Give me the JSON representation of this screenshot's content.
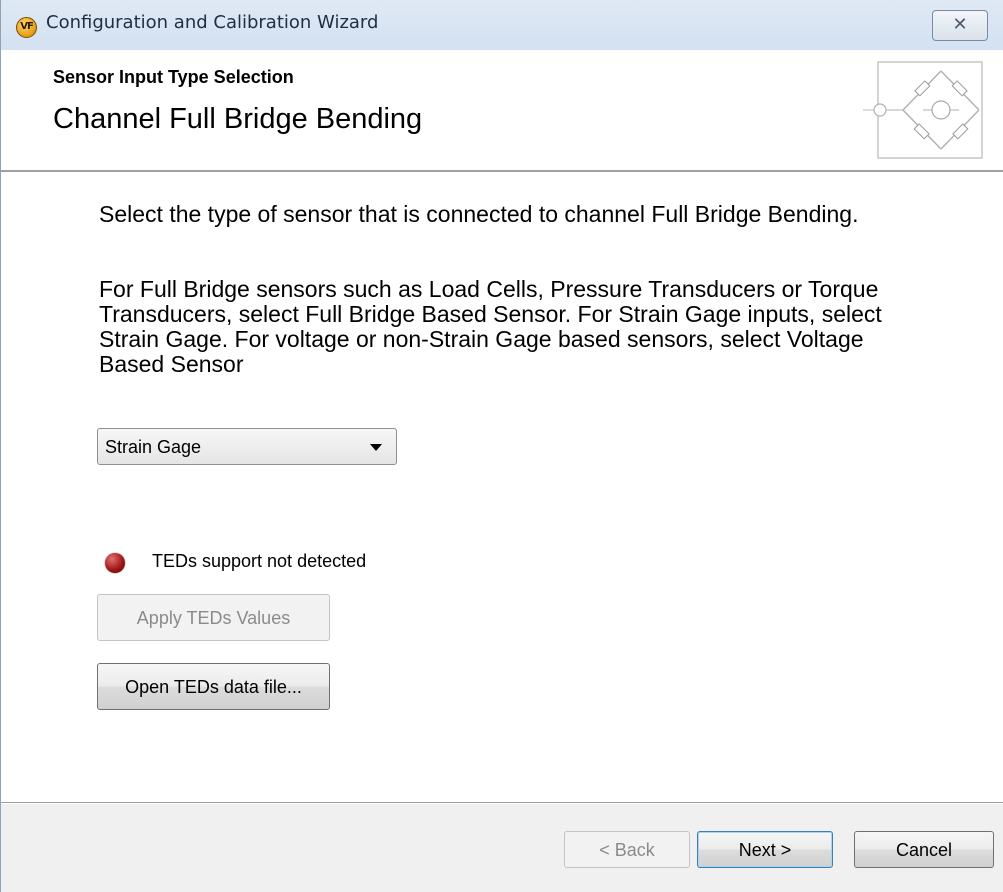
{
  "window": {
    "title": "Configuration and Calibration Wizard",
    "icon_label": "VF",
    "close_label": "✕"
  },
  "header": {
    "subtitle": "Sensor Input Type Selection",
    "title": "Channel Full Bridge Bending",
    "image_icon": "bridge-circuit-icon"
  },
  "content": {
    "instruction": "Select the type of sensor that is connected to channel Full Bridge Bending.",
    "help_text": "For Full Bridge sensors such as Load Cells, Pressure Transducers or Torque Transducers, select Full Bridge Based Sensor.  For Strain Gage inputs, select Strain Gage.  For voltage or non-Strain Gage based sensors, select Voltage Based Sensor",
    "sensor_type_selected": "Strain Gage",
    "teds_status": "TEDs support not detected",
    "teds_status_color": "#a31818",
    "apply_teds_label": "Apply TEDs Values",
    "open_teds_label": "Open TEDs data file..."
  },
  "footer": {
    "back_label": "< Back",
    "next_label": "Next >",
    "cancel_label": "Cancel"
  }
}
